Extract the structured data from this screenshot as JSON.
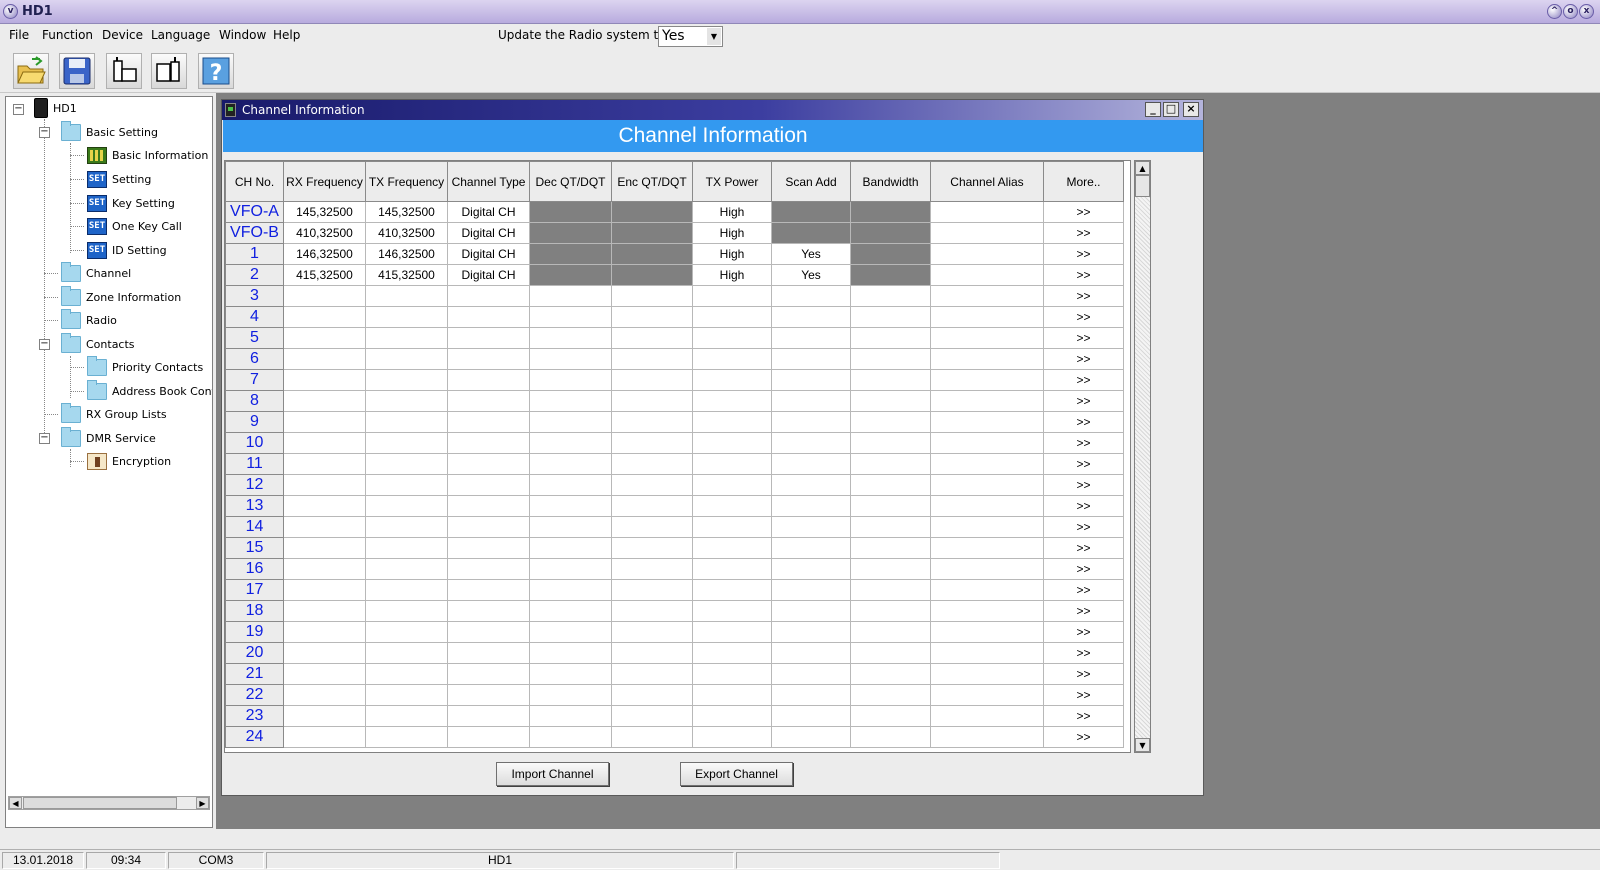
{
  "window": {
    "title": "HD1"
  },
  "menu": {
    "items": [
      "File",
      "Function",
      "Device",
      "Language",
      "Window",
      "Help"
    ],
    "update_label": "Update the Radio system time",
    "update_value": "Yes"
  },
  "toolbar": {
    "buttons": [
      "open-icon",
      "save-icon",
      "read-radio-icon",
      "write-radio-icon",
      "help-icon"
    ]
  },
  "tree": {
    "root": "HD1",
    "basic_setting": "Basic Setting",
    "basic_information": "Basic Information",
    "setting": "Setting",
    "key_setting": "Key Setting",
    "one_key_call": "One Key Call",
    "id_setting": "ID Setting",
    "channel": "Channel",
    "zone_information": "Zone Information",
    "radio": "Radio",
    "contacts": "Contacts",
    "priority_contacts": "Priority Contacts",
    "address_book": "Address Book Conta",
    "rx_group_lists": "RX Group Lists",
    "dmr_service": "DMR Service",
    "encryption": "Encryption",
    "set_icon_text": "SET"
  },
  "child_window": {
    "title": "Channel Information",
    "banner": "Channel Information"
  },
  "channel_table": {
    "columns": [
      "CH No.",
      "RX Frequency",
      "TX Frequency",
      "Channel Type",
      "Dec QT/DQT",
      "Enc QT/DQT",
      "TX Power",
      "Scan Add",
      "Bandwidth",
      "Channel Alias",
      "More.."
    ],
    "rows": [
      {
        "ch": "VFO-A",
        "rx": "145,32500",
        "tx": "145,32500",
        "type": "Digital CH",
        "power": "High",
        "scan": "",
        "more": ">>",
        "gray": [
          4,
          5,
          7,
          8
        ]
      },
      {
        "ch": "VFO-B",
        "rx": "410,32500",
        "tx": "410,32500",
        "type": "Digital CH",
        "power": "High",
        "scan": "",
        "more": ">>",
        "gray": [
          4,
          5,
          7,
          8
        ]
      },
      {
        "ch": "1",
        "rx": "146,32500",
        "tx": "146,32500",
        "type": "Digital CH",
        "power": "High",
        "scan": "Yes",
        "more": ">>",
        "gray": [
          4,
          5,
          8
        ]
      },
      {
        "ch": "2",
        "rx": "415,32500",
        "tx": "415,32500",
        "type": "Digital CH",
        "power": "High",
        "scan": "Yes",
        "more": ">>",
        "gray": [
          4,
          5,
          8
        ]
      },
      {
        "ch": "3",
        "more": ">>"
      },
      {
        "ch": "4",
        "more": ">>"
      },
      {
        "ch": "5",
        "more": ">>"
      },
      {
        "ch": "6",
        "more": ">>"
      },
      {
        "ch": "7",
        "more": ">>"
      },
      {
        "ch": "8",
        "more": ">>"
      },
      {
        "ch": "9",
        "more": ">>"
      },
      {
        "ch": "10",
        "more": ">>"
      },
      {
        "ch": "11",
        "more": ">>"
      },
      {
        "ch": "12",
        "more": ">>"
      },
      {
        "ch": "13",
        "more": ">>"
      },
      {
        "ch": "14",
        "more": ">>"
      },
      {
        "ch": "15",
        "more": ">>"
      },
      {
        "ch": "16",
        "more": ">>"
      },
      {
        "ch": "17",
        "more": ">>"
      },
      {
        "ch": "18",
        "more": ">>"
      },
      {
        "ch": "19",
        "more": ">>"
      },
      {
        "ch": "20",
        "more": ">>"
      },
      {
        "ch": "21",
        "more": ">>"
      },
      {
        "ch": "22",
        "more": ">>"
      },
      {
        "ch": "23",
        "more": ">>"
      },
      {
        "ch": "24",
        "more": ">>"
      }
    ]
  },
  "buttons": {
    "import": "Import Channel",
    "export": "Export Channel"
  },
  "status": {
    "date": "13.01.2018",
    "time": "09:34",
    "port": "COM3",
    "model": "HD1"
  },
  "colors": {
    "banner": "#3399f0",
    "channel_number": "#1020e0",
    "disabled_cell": "#808080"
  }
}
